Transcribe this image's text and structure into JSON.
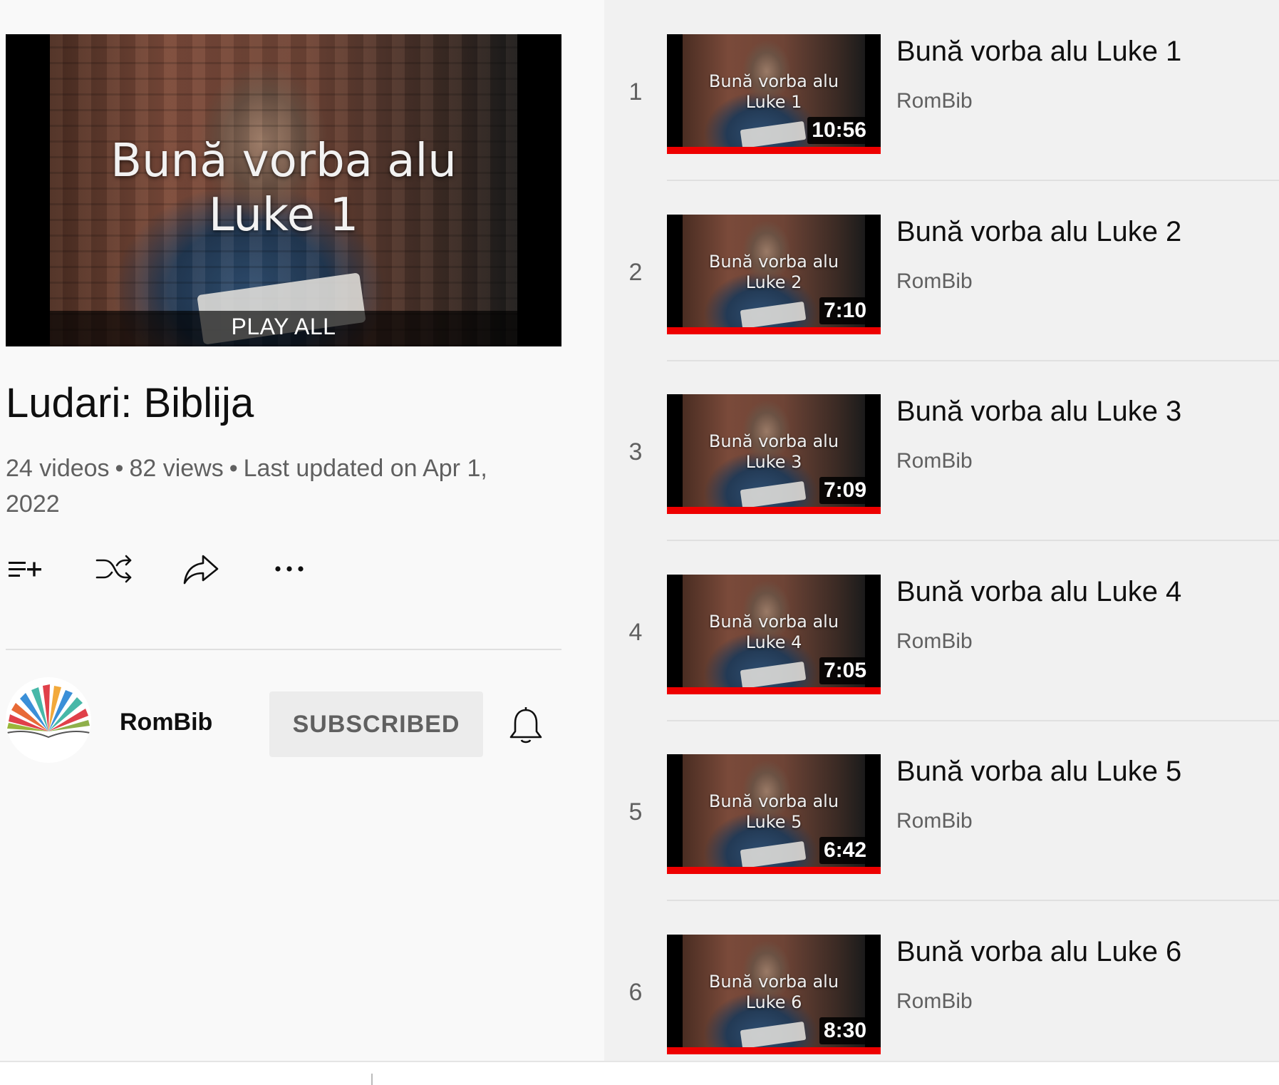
{
  "playlist": {
    "hero_title_line1": "Bună vorba alu",
    "hero_title_line2": "Luke 1",
    "play_all": "PLAY ALL",
    "title": "Ludari: Biblija",
    "stats": {
      "videos": "24 videos",
      "views": "82 views",
      "updated": "Last updated on Apr 1, 2022"
    },
    "actions": [
      {
        "icon": "add-to-queue-icon"
      },
      {
        "icon": "shuffle-icon"
      },
      {
        "icon": "share-icon"
      },
      {
        "icon": "more-icon"
      }
    ]
  },
  "owner": {
    "name": "RomBib",
    "subscribe_label": "SUBSCRIBED",
    "bell_icon": "bell-icon"
  },
  "videos": [
    {
      "index": "1",
      "thumb_line1": "Bună vorba alu",
      "thumb_line2": "Luke 1",
      "duration": "10:56",
      "title": "Bună vorba alu Luke 1",
      "channel": "RomBib",
      "watched": 1.0
    },
    {
      "index": "2",
      "thumb_line1": "Bună vorba alu",
      "thumb_line2": "Luke 2",
      "duration": "7:10",
      "title": "Bună vorba alu Luke 2",
      "channel": "RomBib",
      "watched": 1.0
    },
    {
      "index": "3",
      "thumb_line1": "Bună vorba alu",
      "thumb_line2": "Luke 3",
      "duration": "7:09",
      "title": "Bună vorba alu Luke 3",
      "channel": "RomBib",
      "watched": 1.0
    },
    {
      "index": "4",
      "thumb_line1": "Bună vorba alu",
      "thumb_line2": "Luke 4",
      "duration": "7:05",
      "title": "Bună vorba alu Luke 4",
      "channel": "RomBib",
      "watched": 1.0
    },
    {
      "index": "5",
      "thumb_line1": "Bună vorba alu",
      "thumb_line2": "Luke 5",
      "duration": "6:42",
      "title": "Bună vorba alu Luke 5",
      "channel": "RomBib",
      "watched": 1.0
    },
    {
      "index": "6",
      "thumb_line1": "Bună vorba alu",
      "thumb_line2": "Luke 6",
      "duration": "8:30",
      "title": "Bună vorba alu Luke 6",
      "channel": "RomBib",
      "watched": 1.0
    }
  ],
  "colors": {
    "progress": "#ee0000",
    "list_bg": "#f1f1f1",
    "sidebar_bg": "#f9f9f9"
  }
}
